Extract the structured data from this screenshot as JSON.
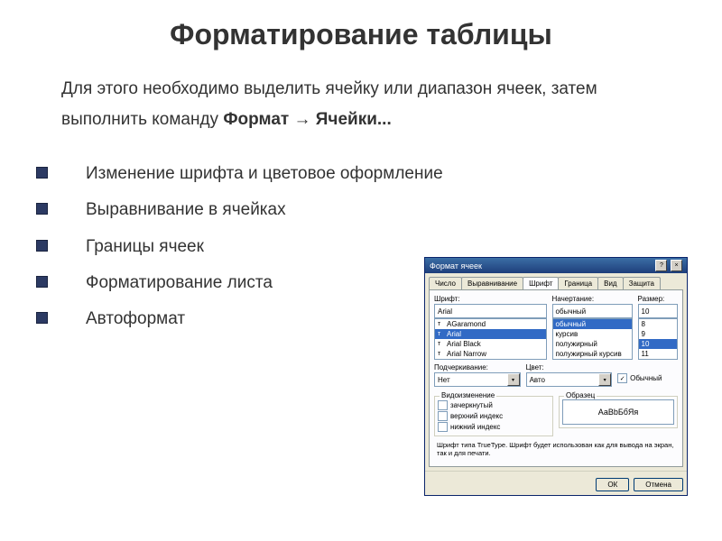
{
  "title": "Форматирование таблицы",
  "intro": {
    "part1": "Для этого необходимо выделить ячейку или диапазон ячеек, затем выполнить команду ",
    "bold1": "Формат",
    "arrow": " → ",
    "bold2": "Ячейки..."
  },
  "bullets": [
    "Изменение шрифта и цветовое оформление",
    "Выравнивание в ячейках",
    "Границы ячеек",
    "Форматирование листа",
    "Автоформат"
  ],
  "dialog": {
    "title": "Формат ячеек",
    "btnHelp": "?",
    "btnClose": "×",
    "tabs": [
      "Число",
      "Выравнивание",
      "Шрифт",
      "Граница",
      "Вид",
      "Защита"
    ],
    "font": {
      "label": "Шрифт:",
      "value": "Arial",
      "items": [
        "AGaramond",
        "Arial",
        "Arial Black",
        "Arial Narrow"
      ]
    },
    "style": {
      "label": "Начертание:",
      "value": "обычный",
      "items": [
        "обычный",
        "курсив",
        "полужирный",
        "полужирный курсив"
      ]
    },
    "size": {
      "label": "Размер:",
      "value": "10",
      "items": [
        "8",
        "9",
        "10",
        "11"
      ]
    },
    "underline": {
      "label": "Подчеркивание:",
      "value": "Нет"
    },
    "color": {
      "label": "Цвет:",
      "value": "Авто"
    },
    "normal": "Обычный",
    "effects": {
      "label": "Видоизменение",
      "items": [
        "зачеркнутый",
        "верхний индекс",
        "нижний индекс"
      ]
    },
    "preview": {
      "label": "Образец",
      "text": "АаВbБбЯя"
    },
    "hint": "Шрифт типа TrueType. Шрифт будет использован как для вывода на экран, так и для печати.",
    "ok": "ОК",
    "cancel": "Отмена"
  }
}
